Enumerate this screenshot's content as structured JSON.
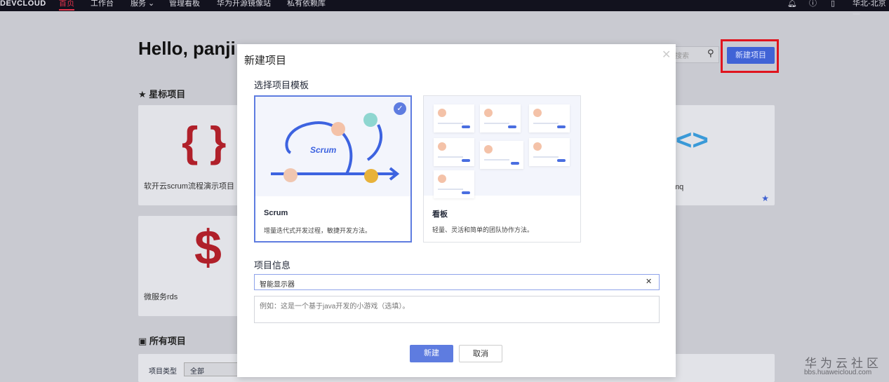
{
  "nav": {
    "logo": "DEVCLOUD",
    "items": [
      "首页",
      "工作台",
      "服务",
      "管理看板",
      "华为开源镜像站",
      "私有依赖库"
    ],
    "region": "华北-北京一"
  },
  "page": {
    "greeting": "Hello, panji",
    "starred_title": "星标项目",
    "all_title": "所有项目",
    "search_placeholder": "搜索",
    "new_project": "新建项目",
    "cards": [
      {
        "label": "软开云scrum流程演示项目"
      },
      {
        "label": "微服务rds"
      },
      {
        "label": "mq"
      }
    ],
    "filter": {
      "label": "项目类型",
      "value": "全部"
    }
  },
  "modal": {
    "title": "新建项目",
    "template_title": "选择项目模板",
    "templates": [
      {
        "name": "Scrum",
        "desc": "增量迭代式开发过程，敏捷开发方法。",
        "selected": true,
        "art_text": "Scrum"
      },
      {
        "name": "看板",
        "desc": "轻量、灵活和简单的团队协作方法。",
        "selected": false
      }
    ],
    "info_title": "项目信息",
    "name_value": "智能显示器",
    "desc_placeholder": "例如：这是一个基于java开发的小游戏（选填）。",
    "create": "新建",
    "cancel": "取消"
  },
  "watermark": {
    "title": "华为云社区",
    "url": "bbs.huaweicloud.com"
  },
  "colors": {
    "accent": "#5e7ce0",
    "highlight": "#e0141e"
  }
}
